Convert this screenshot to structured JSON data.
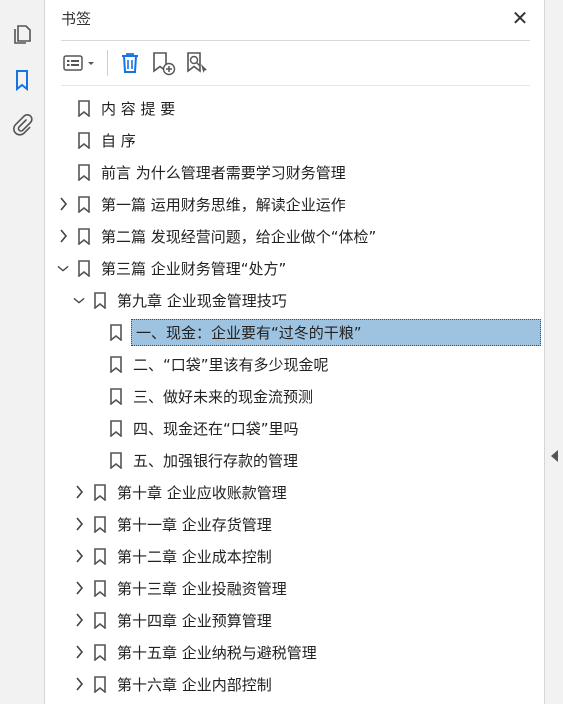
{
  "colors": {
    "selection_bg": "#9ec3e0",
    "delete_icon": "#1473e6",
    "active_nav_icon": "#1473e6"
  },
  "left_nav": [
    {
      "icon": "pages-icon"
    },
    {
      "icon": "bookmark-icon",
      "active": true
    },
    {
      "icon": "paperclip-icon"
    }
  ],
  "panel": {
    "title": "书签",
    "close_glyph": "✕",
    "toolbar": [
      "options-menu-icon",
      "delete-bookmark-icon",
      "new-bookmark-icon",
      "find-bookmark-icon"
    ]
  },
  "bookmarks": [
    {
      "label": "内 容 提 要",
      "level": 0,
      "toggle": "none"
    },
    {
      "label": "自 序",
      "level": 0,
      "toggle": "none"
    },
    {
      "label": "前言 为什么管理者需要学习财务管理",
      "level": 0,
      "toggle": "none"
    },
    {
      "label": "第一篇 运用财务思维，解读企业运作",
      "level": 0,
      "toggle": "collapsed"
    },
    {
      "label": "第二篇 发现经营问题，给企业做个“体检”",
      "level": 0,
      "toggle": "collapsed"
    },
    {
      "label": "第三篇 企业财务管理“处方”",
      "level": 0,
      "toggle": "expanded"
    },
    {
      "label": "第九章 企业现金管理技巧",
      "level": 1,
      "toggle": "expanded"
    },
    {
      "label": "一、现金：企业要有“过冬的干粮”",
      "level": 2,
      "toggle": "none",
      "selected": true
    },
    {
      "label": "二、“口袋”里该有多少现金呢",
      "level": 2,
      "toggle": "none"
    },
    {
      "label": "三、做好未来的现金流预测",
      "level": 2,
      "toggle": "none"
    },
    {
      "label": "四、现金还在“口袋”里吗",
      "level": 2,
      "toggle": "none"
    },
    {
      "label": "五、加强银行存款的管理",
      "level": 2,
      "toggle": "none"
    },
    {
      "label": "第十章 企业应收账款管理",
      "level": 1,
      "toggle": "collapsed"
    },
    {
      "label": "第十一章 企业存货管理",
      "level": 1,
      "toggle": "collapsed"
    },
    {
      "label": "第十二章 企业成本控制",
      "level": 1,
      "toggle": "collapsed"
    },
    {
      "label": "第十三章 企业投融资管理",
      "level": 1,
      "toggle": "collapsed"
    },
    {
      "label": "第十四章 企业预算管理",
      "level": 1,
      "toggle": "collapsed"
    },
    {
      "label": "第十五章 企业纳税与避税管理",
      "level": 1,
      "toggle": "collapsed"
    },
    {
      "label": "第十六章 企业内部控制",
      "level": 1,
      "toggle": "collapsed"
    }
  ]
}
